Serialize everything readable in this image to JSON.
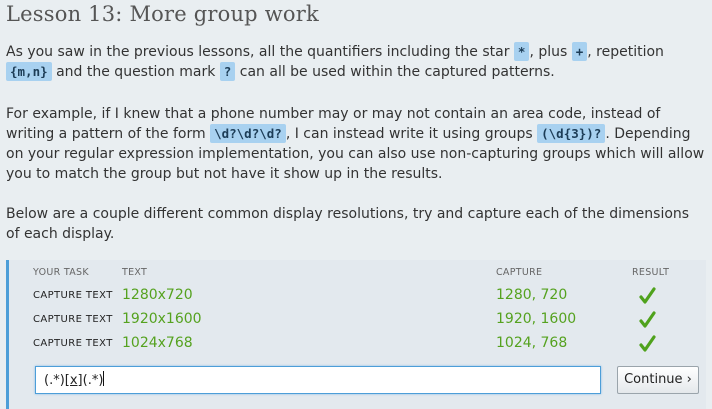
{
  "lesson": {
    "title": "Lesson 13: More group work"
  },
  "para1": {
    "t1": "As you saw in the previous lessons, all the quantifiers including the star ",
    "c1": "*",
    "t2": ", plus ",
    "c2": "+",
    "t3": ", repetition ",
    "c3": "{m,n}",
    "t4": " and the question mark ",
    "c4": "?",
    "t5": " can all be used within the captured patterns."
  },
  "para2": {
    "t1": "For example, if I knew that a phone number may or may not contain an area code, instead of writing a pattern of the form ",
    "c1": "\\d?\\d?\\d?",
    "t2": ", I can instead write it using groups ",
    "c2": "(\\d{3})?",
    "t3": ". Depending on your regular expression implementation, you can also use non-capturing groups which will allow you to match the group but not have it show up in the results."
  },
  "para3": {
    "text": "Below are a couple different common display resolutions, try and capture each of the dimensions of each display."
  },
  "task_table": {
    "headers": {
      "task": "YOUR TASK",
      "text": "TEXT",
      "capture": "CAPTURE",
      "result": "RESULT"
    },
    "rows": [
      {
        "task": "CAPTURE TEXT",
        "text": "1280x720",
        "capture": "1280, 720",
        "result_icon": "checkmark-icon"
      },
      {
        "task": "CAPTURE TEXT",
        "text": "1920x1600",
        "capture": "1920, 1600",
        "result_icon": "checkmark-icon"
      },
      {
        "task": "CAPTURE TEXT",
        "text": "1024x768",
        "capture": "1024, 768",
        "result_icon": "checkmark-icon"
      }
    ]
  },
  "regex_input": {
    "value_before": "(.*)",
    "value_bracket": "[x]",
    "value_after": "(.*)"
  },
  "continue_button": {
    "label": "Continue ›"
  },
  "colors": {
    "accent": "#4d9ed8",
    "match_text": "#55a21f",
    "checkmark": "#4fa21c",
    "code_bg": "#a8d1f0"
  }
}
